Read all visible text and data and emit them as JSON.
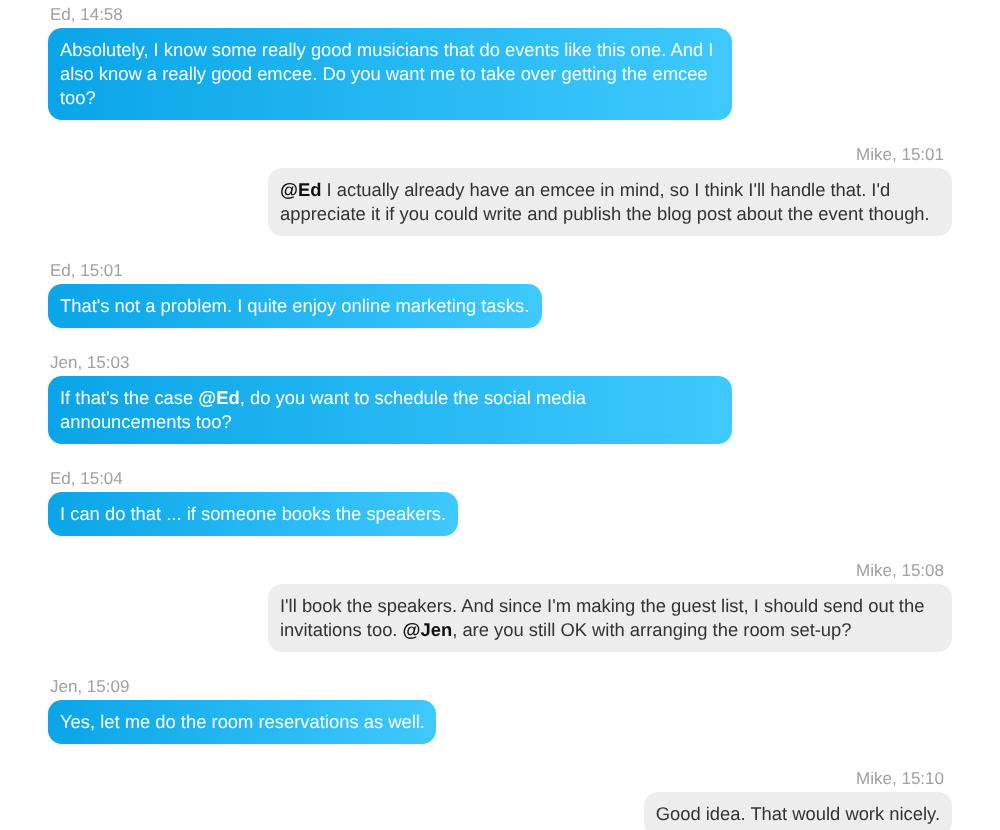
{
  "messages": [
    {
      "kind": "received",
      "meta": "Ed, 14:58",
      "text": "Absolutely, I know some really good musicians that do events like this one. And I also know a really good emcee. Do you want me to take over getting the emcee too?"
    },
    {
      "kind": "sent",
      "meta": "Mike, 15:01",
      "text": "**@Ed** I actually already have an emcee in mind, so I think I'll handle that. I'd appreciate it if you could write and publish the blog post about the event though."
    },
    {
      "kind": "received",
      "meta": "Ed, 15:01",
      "text": "That's not a problem. I quite enjoy online marketing tasks."
    },
    {
      "kind": "received",
      "meta": "Jen, 15:03",
      "text": "If that's the case **@Ed**, do you want to schedule the social media announcements too?"
    },
    {
      "kind": "received",
      "meta": "Ed, 15:04",
      "text": "I can do that ... if someone books the speakers."
    },
    {
      "kind": "sent",
      "meta": "Mike, 15:08",
      "text": "I'll book the speakers. And since I'm making the guest list, I should send out the invitations too. **@Jen**, are you still OK with arranging the room set-up?"
    },
    {
      "kind": "received",
      "meta": "Jen, 15:09",
      "text": "Yes, let me do the room reservations as well."
    },
    {
      "kind": "sent",
      "meta": "Mike, 15:10",
      "text": "Good idea. That would work nicely."
    }
  ]
}
